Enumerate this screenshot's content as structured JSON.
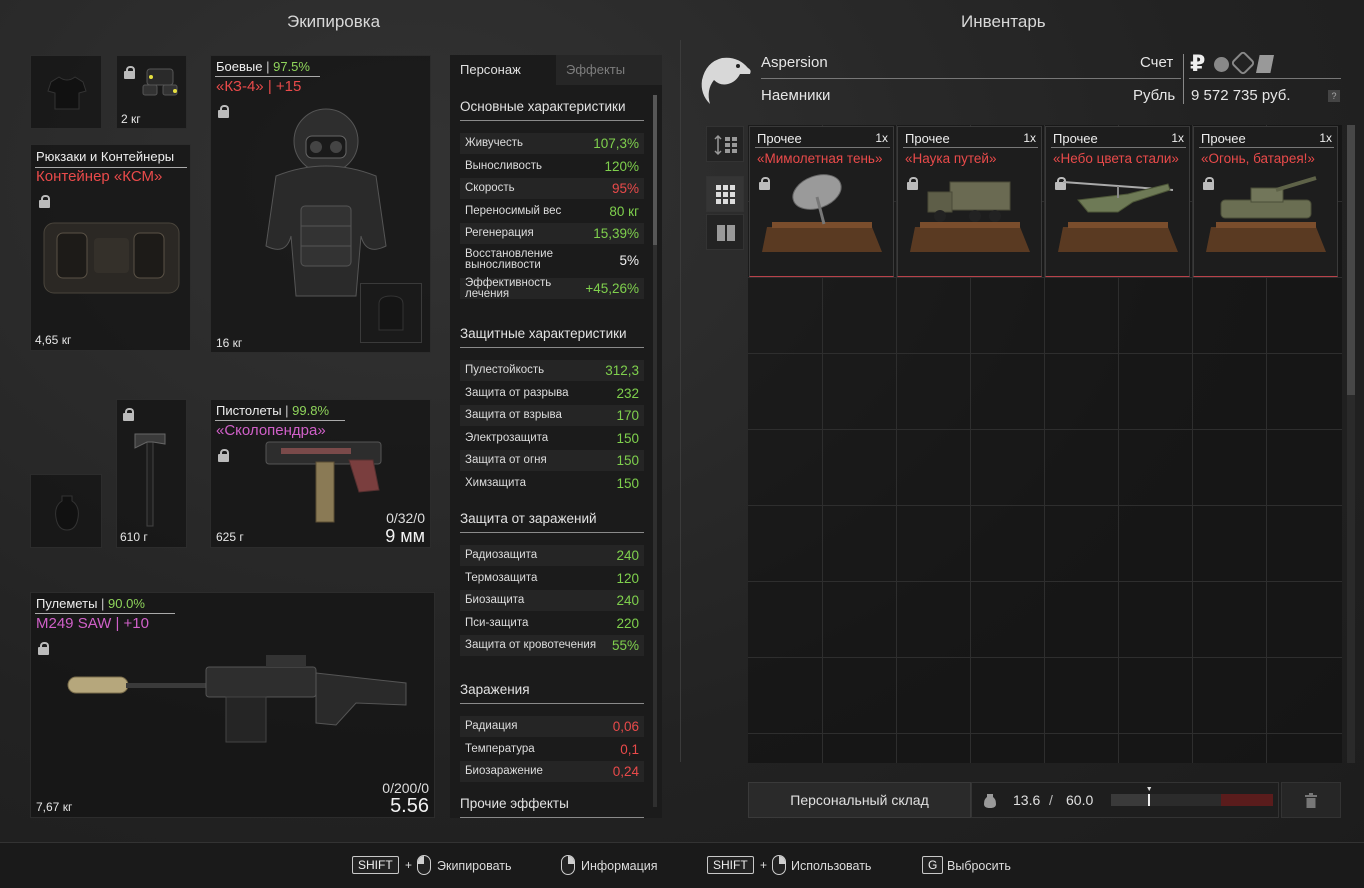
{
  "equipment": {
    "title": "Экипировка",
    "slots": {
      "tshirt": {
        "weight": ""
      },
      "device": {
        "weight": "2 кг"
      },
      "armor": {
        "category": "Боевые",
        "durability": "97.5%",
        "name": "«КЗ-4» | +15",
        "weight": "16 кг"
      },
      "backpack": {
        "category": "Рюкзаки и Контейнеры",
        "name": "Контейнер «КСМ»",
        "weight": "4,65 кг"
      },
      "melee": {
        "weight": "610 г"
      },
      "pistol": {
        "category": "Пистолеты",
        "durability": "99.8%",
        "name": "«Сколопендра»",
        "weight": "625 г",
        "ammo": "0/32/0",
        "caliber": "9 мм"
      },
      "machinegun": {
        "category": "Пулеметы",
        "durability": "90.0%",
        "name": "M249 SAW | +10",
        "weight": "7,67 кг",
        "ammo": "0/200/0",
        "caliber": "5.56"
      }
    }
  },
  "stats": {
    "tabs": [
      "Персонаж",
      "Эффекты"
    ],
    "sections": [
      {
        "title": "Основные характеристики",
        "rows": [
          {
            "label": "Живучесть",
            "value": "107,3%",
            "color": "green"
          },
          {
            "label": "Выносливость",
            "value": "120%",
            "color": "green"
          },
          {
            "label": "Скорость",
            "value": "95%",
            "color": "red"
          },
          {
            "label": "Переносимый вес",
            "value": "80 кг",
            "color": "green"
          },
          {
            "label": "Регенерация",
            "value": "15,39%",
            "color": "green"
          },
          {
            "label": "Восстановление выносливости",
            "value": "5%",
            "color": "white"
          },
          {
            "label": "Эффективность лечения",
            "value": "+45,26%",
            "color": "green"
          }
        ]
      },
      {
        "title": "Защитные характеристики",
        "rows": [
          {
            "label": "Пулестойкость",
            "value": "312,3",
            "color": "green"
          },
          {
            "label": "Защита от разрыва",
            "value": "232",
            "color": "green"
          },
          {
            "label": "Защита от взрыва",
            "value": "170",
            "color": "green"
          },
          {
            "label": "Электрозащита",
            "value": "150",
            "color": "green"
          },
          {
            "label": "Защита от огня",
            "value": "150",
            "color": "green"
          },
          {
            "label": "Химзащита",
            "value": "150",
            "color": "green"
          }
        ]
      },
      {
        "title": "Защита от заражений",
        "rows": [
          {
            "label": "Радиозащита",
            "value": "240",
            "color": "green"
          },
          {
            "label": "Термозащита",
            "value": "120",
            "color": "green"
          },
          {
            "label": "Биозащита",
            "value": "240",
            "color": "green"
          },
          {
            "label": "Пси-защита",
            "value": "220",
            "color": "green"
          },
          {
            "label": "Защита от кровотечения",
            "value": "55%",
            "color": "green"
          }
        ]
      },
      {
        "title": "Заражения",
        "rows": [
          {
            "label": "Радиация",
            "value": "0,06",
            "color": "red"
          },
          {
            "label": "Температура",
            "value": "0,1",
            "color": "red"
          },
          {
            "label": "Биозаражение",
            "value": "0,24",
            "color": "red"
          }
        ]
      },
      {
        "title": "Прочие эффекты",
        "rows": []
      }
    ]
  },
  "inventory": {
    "title": "Инвентарь",
    "player_name": "Aspersion",
    "faction": "Наемники",
    "account_label": "Счет",
    "currency_label": "Рубль",
    "balance": "9 572 735 руб.",
    "help": "?",
    "items": [
      {
        "category": "Прочее",
        "qty": "1x",
        "name": "«Мимолетная тень»"
      },
      {
        "category": "Прочее",
        "qty": "1x",
        "name": "«Наука путей»"
      },
      {
        "category": "Прочее",
        "qty": "1x",
        "name": "«Небо цвета стали»"
      },
      {
        "category": "Прочее",
        "qty": "1x",
        "name": "«Огонь, батарея!»"
      }
    ],
    "storage_button": "Персональный склад",
    "weight_current": "13.6",
    "weight_sep": "/",
    "weight_max": "60.0",
    "weight_fill": 0.227
  },
  "footer": {
    "equip_key": "SHIFT",
    "equip_label": "Экипировать",
    "info_label": "Информация",
    "use_key": "SHIFT",
    "use_label": "Использовать",
    "drop_key": "G",
    "drop_label": "Выбросить",
    "plus": "+"
  },
  "colors": {
    "red": "#e94a4a",
    "green": "#7fd04d",
    "pink": "#d060c8",
    "white": "#f0f0f0"
  }
}
